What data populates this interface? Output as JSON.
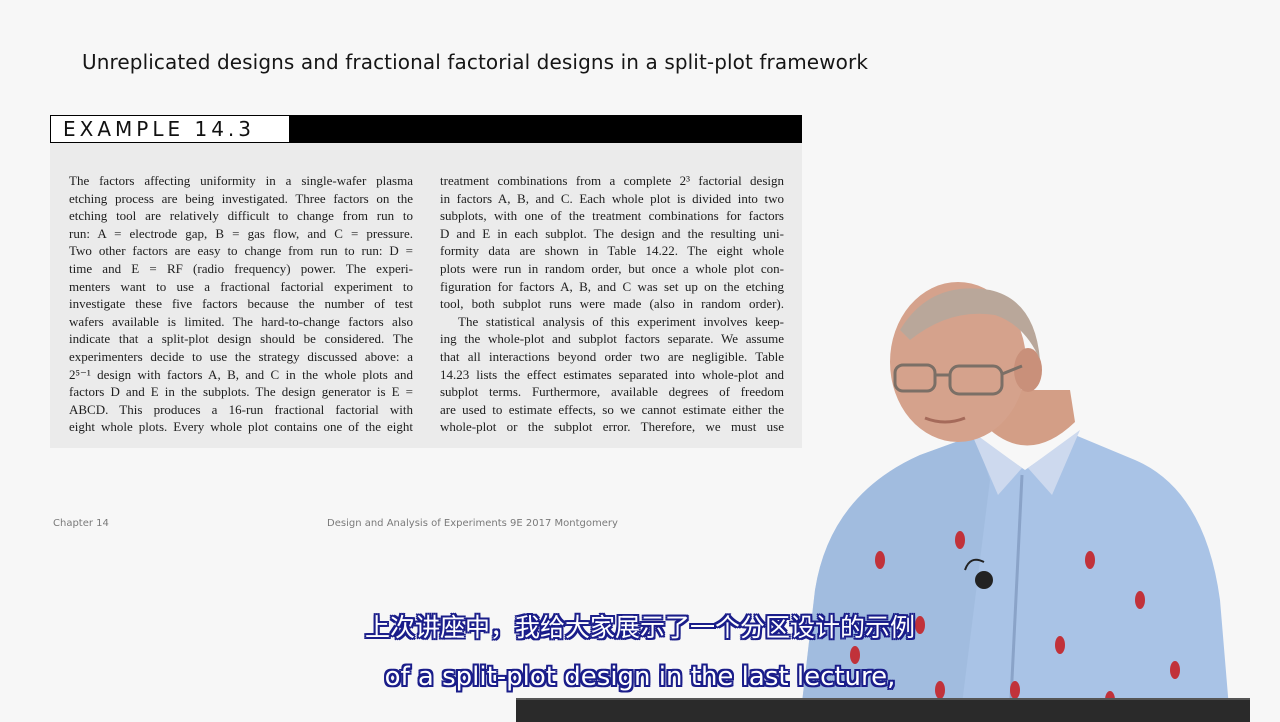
{
  "slide": {
    "title": "Unreplicated designs and fractional factorial designs in a split-plot framework",
    "example_label": "EXAMPLE 14.3"
  },
  "example": {
    "left_column": [
      "The factors affecting uniformity in a single-wafer plasma",
      "etching process are being investigated. Three factors on the",
      "etching tool are relatively difficult to change from run to",
      "run: A = electrode gap, B = gas flow, and C = pressure.",
      "Two other factors are easy to change from run to run: D =",
      "time and E = RF (radio frequency) power. The experi-",
      "menters want to use a fractional factorial experiment to",
      "investigate these five factors because the number of test",
      "wafers available is limited. The hard-to-change factors also",
      "indicate that a split-plot design should be considered. The",
      "experimenters decide to use the strategy discussed above: a",
      "2⁵⁻¹ design with factors A, B, and C in the whole plots and",
      "factors D and E in the subplots. The design generator is E =",
      "ABCD. This produces a 16-run fractional factorial with",
      "eight whole plots. Every whole plot contains one of the eight"
    ],
    "right_column": [
      "treatment combinations from a complete 2³ factorial design",
      "in factors A, B, and C. Each whole plot is divided into two",
      "subplots, with one of the treatment combinations for factors",
      "D and E in each subplot. The design and the resulting uni-",
      "formity data are shown in Table 14.22. The eight whole",
      "plots were run in random order, but once a whole plot con-",
      "figuration for factors A, B, and C was set up on the etching",
      "tool, both subplot runs were made (also in random order).",
      "The statistical analysis of this experiment involves keep-",
      "ing the whole-plot and subplot factors separate. We assume",
      "that all interactions beyond order two are negligible. Table",
      "14.23 lists the effect estimates separated into whole-plot and",
      "subplot terms. Furthermore, available degrees of freedom",
      "are used to estimate effects, so we cannot estimate either the",
      "whole-plot or the subplot error. Therefore, we must use"
    ]
  },
  "footer": {
    "chapter": "Chapter 14",
    "source": "Design and Analysis of Experiments 9E 2017 Montgomery"
  },
  "subtitles": {
    "chinese": "上次讲座中，我给大家展示了一个分区设计的示例",
    "english": "of a split-plot design in the last lecture,"
  },
  "colors": {
    "subtitle_outline": "#1a1d8a",
    "shirt": "#a9c3e6",
    "header_bar": "#000000"
  }
}
